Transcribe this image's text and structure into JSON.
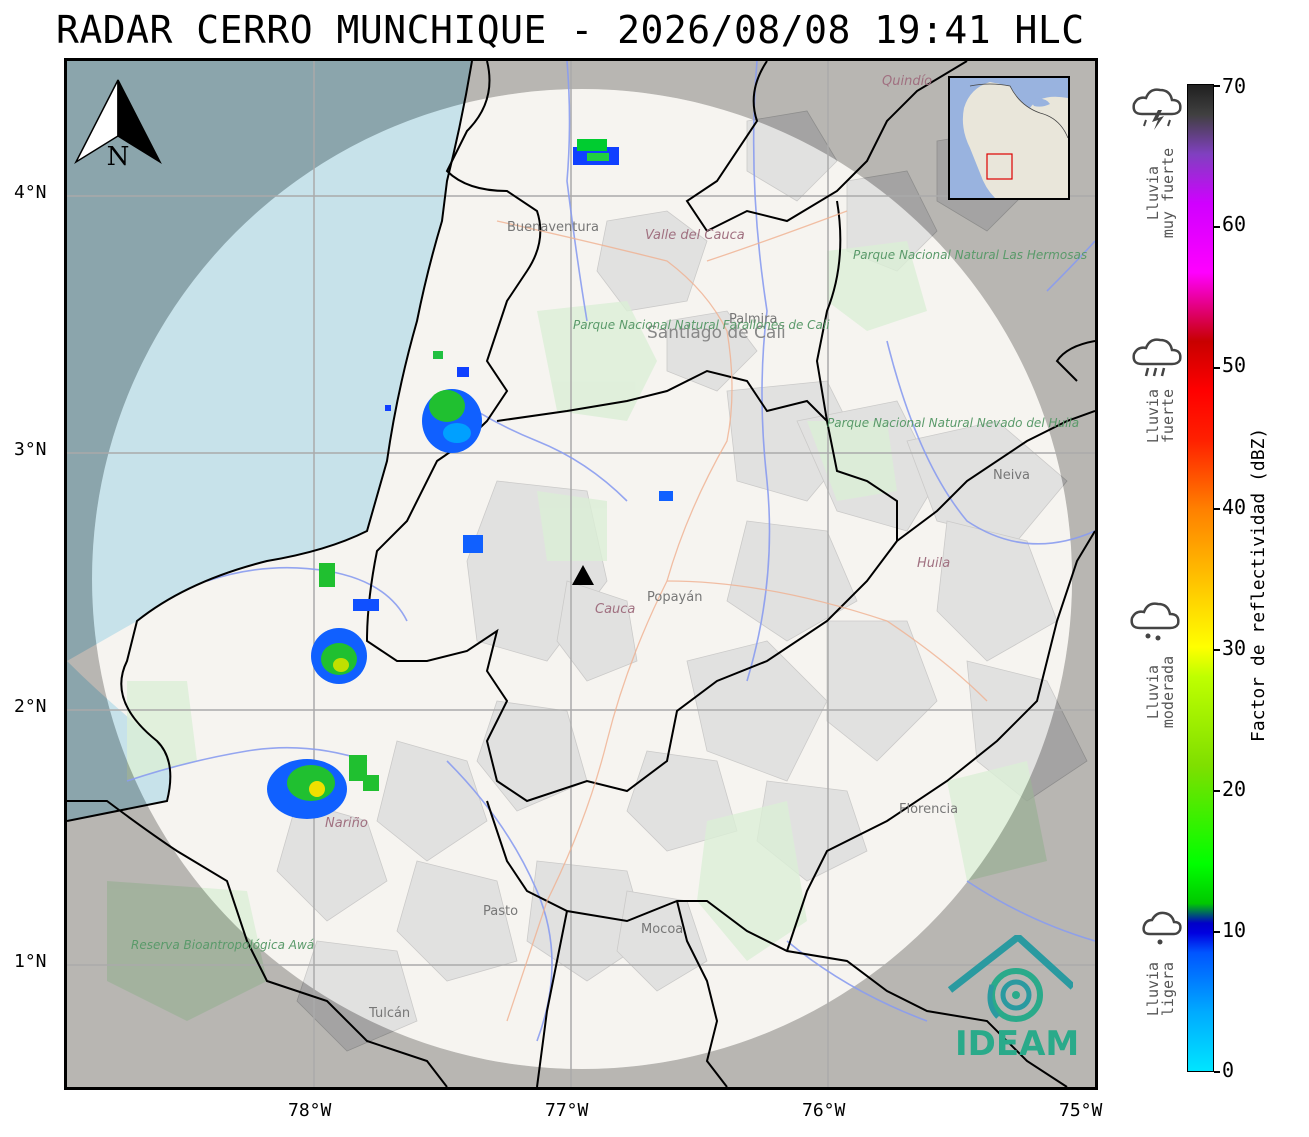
{
  "title": "RADAR CERRO MUNCHIQUE - 2026/08/08 19:41 HLC",
  "axes": {
    "lat_labels": [
      "4°N",
      "3°N",
      "2°N",
      "1°N"
    ],
    "lon_labels": [
      "78°W",
      "77°W",
      "76°W",
      "75°W"
    ]
  },
  "north_arrow": {
    "label": "N",
    "icon": "north-arrow-icon"
  },
  "colorbar": {
    "title": "Factor de reflectividad (dBZ)",
    "ticks": [
      "70",
      "60",
      "50",
      "40",
      "30",
      "20",
      "10",
      "0"
    ],
    "range": [
      0,
      70
    ],
    "colors": [
      "#00e5ff",
      "#0000e0",
      "#00ff00",
      "#ffff00",
      "#ff8000",
      "#ff0000",
      "#ff00ff",
      "#202020"
    ]
  },
  "rain_categories": [
    {
      "line1": "Lluvia",
      "line2": "muy fuerte",
      "icon": "storm-cloud-icon"
    },
    {
      "line1": "Lluvia",
      "line2": "fuerte",
      "icon": "heavy-rain-cloud-icon"
    },
    {
      "line1": "Lluvia",
      "line2": "moderada",
      "icon": "rain-cloud-icon"
    },
    {
      "line1": "Lluvia",
      "line2": "ligera",
      "icon": "light-rain-cloud-icon"
    }
  ],
  "place_labels": {
    "quindio": "Quindío",
    "buenaventura": "Buenaventura",
    "valle": "Valle del Cauca",
    "palmira": "Palmira",
    "cali": "Santiago de Cali",
    "farallones": "Parque Nacional Natural Farallones de Cali",
    "hermosas": "Parque Nacional Natural Las Hermosas",
    "nevado": "Parque Nacional Natural Nevado del Huila",
    "neiva": "Neiva",
    "huila": "Huila",
    "cauca": "Cauca",
    "popayan": "Popayán",
    "narino": "Nariño",
    "pasto": "Pasto",
    "mocoa": "Mocoa",
    "florencia": "Florencia",
    "tulcan": "Tulcán",
    "awa": "Reserva Bioantropológica Awá"
  },
  "logo": {
    "text": "IDEAM",
    "color": "#2aaa8a"
  },
  "radar_site": {
    "icon": "radar-site-icon",
    "lon": -76.96,
    "lat": 2.48
  }
}
